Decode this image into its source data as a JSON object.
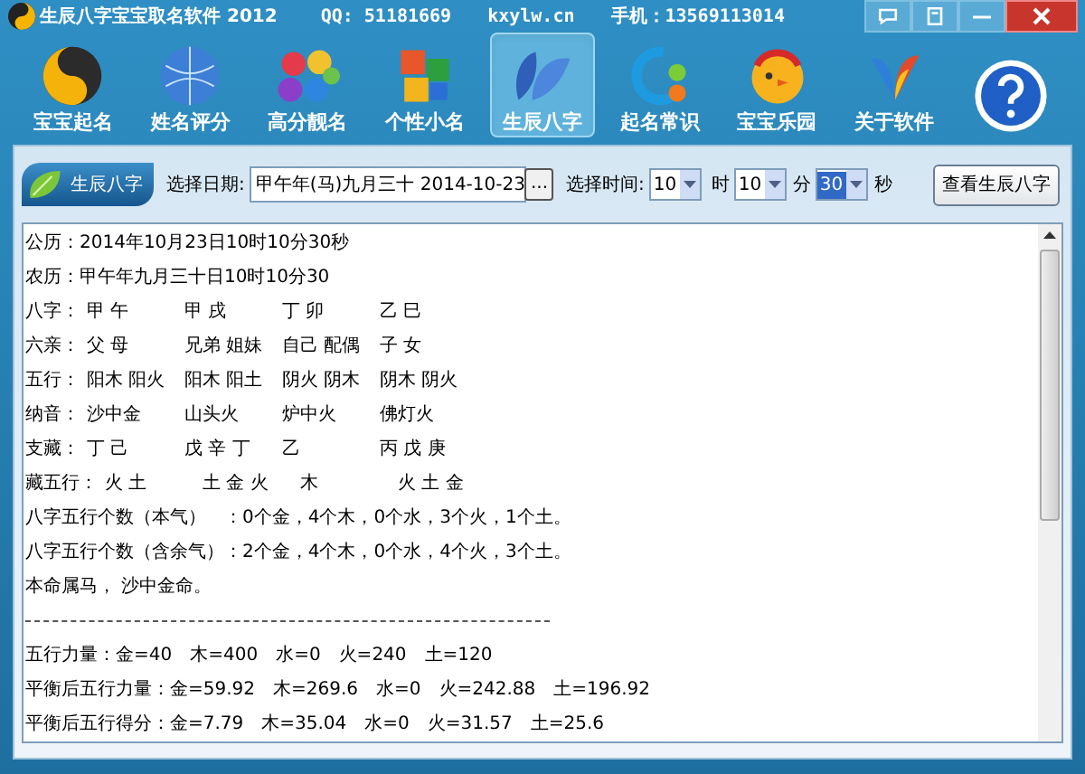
{
  "window": {
    "title": "生辰八字宝宝取名软件 2012",
    "qq": "QQ: 51181669",
    "site": "kxylw.cn",
    "phone": "手机：13569113014"
  },
  "toolbar": [
    {
      "kind": "yinyang",
      "label": "宝宝起名",
      "selected": false
    },
    {
      "kind": "globe",
      "label": "姓名评分",
      "selected": false
    },
    {
      "kind": "hexagons",
      "label": "高分靓名",
      "selected": false
    },
    {
      "kind": "squares",
      "label": "个性小名",
      "selected": false
    },
    {
      "kind": "petals",
      "label": "生辰八字",
      "selected": true
    },
    {
      "kind": "dots",
      "label": "起名常识",
      "selected": false
    },
    {
      "kind": "chick",
      "label": "宝宝乐园",
      "selected": false
    },
    {
      "kind": "wings",
      "label": "关于软件",
      "selected": false
    },
    {
      "kind": "help",
      "selected": false
    }
  ],
  "form": {
    "badge": "生辰八字",
    "date_label": "选择日期:",
    "date_value": "甲午年(马)九月三十 2014-10-23",
    "date_button": "...",
    "time_label": "选择时间:",
    "hour": "10",
    "hour_unit": "时",
    "minute": "10",
    "minute_unit": "分",
    "second": "30",
    "second_unit": "秒",
    "submit": "查看生辰八字"
  },
  "lines": [
    {
      "kind": "text",
      "text": "公历：2014年10月23日10时10分30秒"
    },
    {
      "kind": "text",
      "text": "农历：甲午年九月三十日10时10分30"
    },
    {
      "kind": "columns",
      "label": "八字：",
      "columns": [
        "甲 午",
        "甲 戌",
        "丁 卯",
        "乙 巳"
      ]
    },
    {
      "kind": "columns",
      "label": "六亲：",
      "columns": [
        "父 母",
        "兄弟 姐妹",
        "自己 配偶",
        "子 女"
      ]
    },
    {
      "kind": "columns",
      "label": "五行：",
      "columns": [
        "阳木 阳火",
        "阳木 阳土",
        "阴火 阴木",
        "阴木 阴火"
      ]
    },
    {
      "kind": "columns",
      "label": "纳音：",
      "columns": [
        "沙中金",
        "山头火",
        "炉中火",
        "佛灯火"
      ]
    },
    {
      "kind": "columns",
      "label": "支藏：",
      "columns": [
        "丁 己",
        "戊 辛 丁",
        "乙",
        "丙 戊 庚"
      ]
    },
    {
      "kind": "columns",
      "label": "藏五行：",
      "columns": [
        "火 土",
        "土 金 火",
        "木",
        "火 土 金"
      ]
    },
    {
      "kind": "text",
      "text": "八字五行个数（本气）　：0个金，4个木，0个水，3个火，1个土。"
    },
    {
      "kind": "text",
      "text": "八字五行个数（含余气）：2个金，4个木，0个水，4个火，3个土。"
    },
    {
      "kind": "text",
      "text": "本命属马， 沙中金命。"
    },
    {
      "kind": "rule"
    },
    {
      "kind": "text",
      "text": "五行力量：金=40　木=400　水=0　火=240　土=120"
    },
    {
      "kind": "text",
      "text": "平衡后五行力量：金=59.92　木=269.6　水=0　火=242.88　土=196.92"
    },
    {
      "kind": "text",
      "text": "平衡后五行得分：金=7.79　木=35.04　水=0　火=31.57　土=25.6"
    }
  ]
}
